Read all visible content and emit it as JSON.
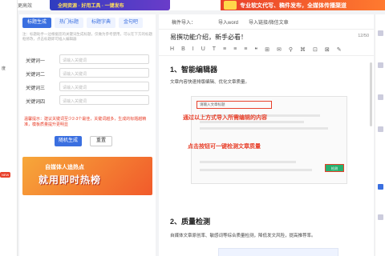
{
  "topbar": {
    "history": "让创作更高效"
  },
  "banner_left": {
    "text": "全网资源 · 好用工具 · 一键发布"
  },
  "banner_right": {
    "text": "专业软文代写、稿件发布，全媒体传播渠道"
  },
  "leftnav": {
    "items": [
      "度",
      "",
      "",
      "",
      ""
    ],
    "new_tag": "NEW"
  },
  "tool": {
    "tabs": [
      "标题生成",
      "热门标题",
      "标题字典",
      "金句吧"
    ],
    "hint": "注：标题助手一边根据您的关键词生成标题，仅做为参考使用，可以在下方的标题框修改，点击标题即可插入编辑器",
    "keywords": [
      {
        "label": "关键词一",
        "placeholder": "请输入关键词"
      },
      {
        "label": "关键词二",
        "placeholder": "请输入关键词"
      },
      {
        "label": "关键词三",
        "placeholder": "请输入关键词"
      },
      {
        "label": "关键词四",
        "placeholder": "请输入关键词"
      }
    ],
    "tip": "温馨提示：建议关键词至少2-3个最佳，关键词越多，生成的标题越精准，模板质量提升更明显",
    "generate_label": "随机生成",
    "reset_label": "重置",
    "ad_line1": "自媒体人追热点",
    "ad_line2": "就用即时热榜"
  },
  "editor": {
    "import_label": "稿件导入：",
    "import_word": "导入word",
    "import_link": "导入链接/微信文章",
    "title": "易撰功能介绍，新手必看！",
    "count": "12/50",
    "toolbar": [
      "H",
      "B",
      "I",
      "U",
      "T",
      "≡",
      "≡",
      "≡",
      "❝",
      "⊞",
      "✉",
      "⚲",
      "⌘",
      "⊡",
      "⊠",
      "✎"
    ],
    "section1": "1、智能编辑器",
    "section1_text": "文章内容快速排版编辑、优化文章质量。",
    "screenshot_input": "请输入文章标题",
    "note1": "通过以上方式导入所需编辑的内容",
    "note2": "点击按钮可一键检测文章质量",
    "green_btn": "检测",
    "section2": "2、质量检测",
    "section2_text": "自媒体文章原创率、敏感词等综合质量检测，降低发文风险，提高推荐率。"
  },
  "colors": {
    "accent": "#3a6fe0",
    "warn": "#e8402b",
    "green": "#27b06f"
  }
}
